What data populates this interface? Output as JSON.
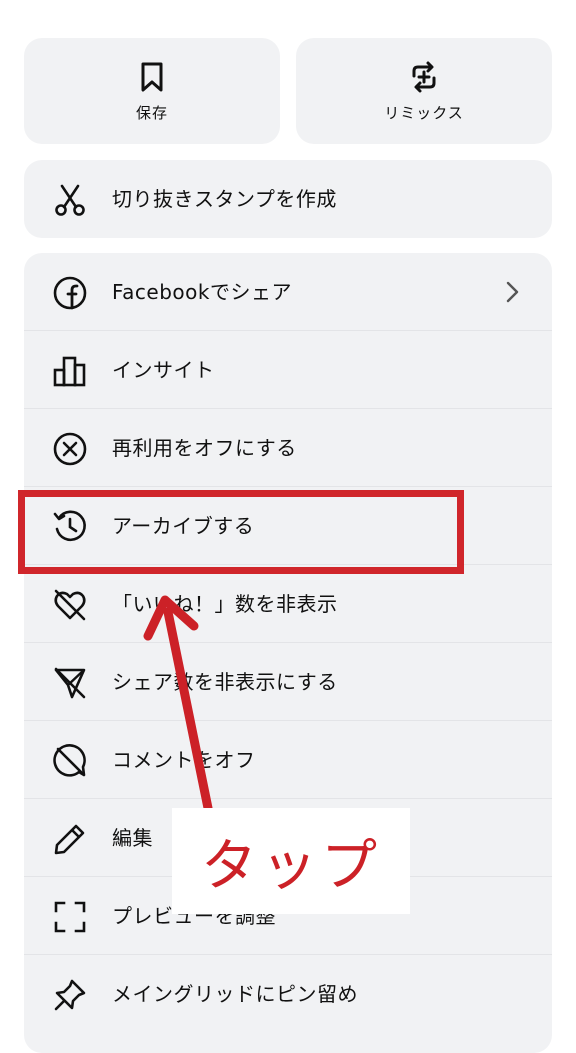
{
  "top_tiles": {
    "save": {
      "label": "保存",
      "icon": "bookmark-icon"
    },
    "remix": {
      "label": "リミックス",
      "icon": "remix-icon"
    }
  },
  "cutout": {
    "label": "切り抜きスタンプを作成",
    "icon": "scissors-icon"
  },
  "menu": {
    "items": [
      {
        "label": "Facebookでシェア",
        "icon": "facebook-icon"
      },
      {
        "label": "インサイト",
        "icon": "bar-chart-icon"
      },
      {
        "label": "再利用をオフにする",
        "icon": "x-circle-icon"
      },
      {
        "label": "アーカイブする",
        "icon": "archive-history-icon"
      },
      {
        "label": "「いいね！」数を非表示",
        "icon": "heart-off-icon"
      },
      {
        "label": "シェア数を非表示にする",
        "icon": "share-off-icon"
      },
      {
        "label": "コメントをオフ",
        "icon": "comment-off-icon"
      },
      {
        "label": "編集",
        "icon": "pencil-icon"
      },
      {
        "label": "プレビューを調整",
        "icon": "crop-corners-icon"
      },
      {
        "label": "メイングリッドにピン留め",
        "icon": "pin-icon"
      }
    ]
  },
  "annotation": {
    "callout_text": "タップ",
    "color": "#d0262b"
  }
}
